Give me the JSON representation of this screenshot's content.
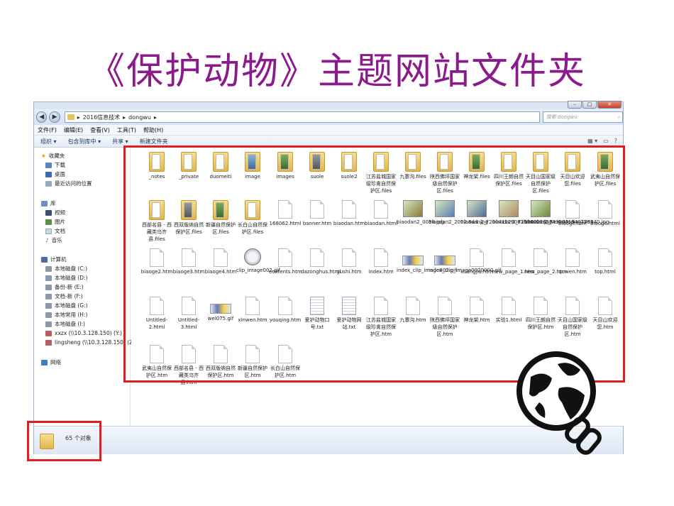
{
  "slide": {
    "title": "《保护动物》主题网站文件夹"
  },
  "explorer": {
    "address": {
      "segments": [
        "2016信息技术",
        "dongwu"
      ]
    },
    "search_placeholder": "搜索 dongwu",
    "menu": [
      "文件(F)",
      "编辑(E)",
      "查看(V)",
      "工具(T)",
      "帮助(H)"
    ],
    "toolbar": [
      "组织 ▾",
      "包含到库中 ▾",
      "共享 ▾",
      "新建文件夹"
    ],
    "sidebar": {
      "favorites": {
        "label": "收藏夹",
        "items": [
          "下载",
          "桌面",
          "最近访问的位置"
        ]
      },
      "libraries": {
        "label": "库",
        "items": [
          "视频",
          "图片",
          "文档",
          "音乐"
        ]
      },
      "computer": {
        "label": "计算机",
        "items": [
          "本地磁盘 (C:)",
          "本地磁盘 (D:)",
          "备份-新 (E:)",
          "文档-新 (F:)",
          "本地磁盘 (G:)",
          "本地常用 (H:)",
          "本地磁盘 (I:)",
          "xxzx (\\\\10.3.128.150) (Y:)",
          "lingsheng (\\\\10.3.128.150) (Z:)"
        ]
      },
      "network": {
        "label": "网络"
      }
    },
    "items": [
      {
        "name": "_notes",
        "type": "folder"
      },
      {
        "name": "_private",
        "type": "folder"
      },
      {
        "name": "duomeiti",
        "type": "folder"
      },
      {
        "name": "image",
        "type": "folder-blue"
      },
      {
        "name": "images",
        "type": "folder-green"
      },
      {
        "name": "suole",
        "type": "folder-gray"
      },
      {
        "name": "suole2",
        "type": "folder"
      },
      {
        "name": "江苏盐城国家级珍禽自然保护区.files",
        "type": "folder"
      },
      {
        "name": "九寨沟.files",
        "type": "folder"
      },
      {
        "name": "陕西佛坪国家级自然保护区.files",
        "type": "folder"
      },
      {
        "name": "神龙架.files",
        "type": "folder-green"
      },
      {
        "name": "四川王朗自然保护区.files",
        "type": "folder"
      },
      {
        "name": "天目山国家级自然保护区.files",
        "type": "folder"
      },
      {
        "name": "天目山欢迎您.files",
        "type": "folder"
      },
      {
        "name": "武夷山自然保护区.files",
        "type": "folder-green"
      },
      {
        "name": "西部名县 - 西藏类乌齐县.files",
        "type": "folder"
      },
      {
        "name": "西双版纳自然保护区.files",
        "type": "folder-gray"
      },
      {
        "name": "新疆自然保护区.files",
        "type": "folder-green"
      },
      {
        "name": "长白山自然保护区.files",
        "type": "folder"
      },
      {
        "name": "168062.html",
        "type": "file"
      },
      {
        "name": "banner.htm",
        "type": "file"
      },
      {
        "name": "biaodan.htm",
        "type": "file"
      },
      {
        "name": "biaodan.html",
        "type": "file"
      },
      {
        "name": "biaodan2_0038.jpg",
        "type": "photo",
        "color": "#8a7a3a"
      },
      {
        "name": "biaodan2_2002.8w1.jpg",
        "type": "photo",
        "color": "#5b7fb0"
      },
      {
        "name": "biaodan2_F20041129083534000.jpg",
        "type": "photo",
        "color": "#4a6a9a"
      },
      {
        "name": "biaodan2_F20060216174359319492989...",
        "type": "photo",
        "color": "#b08860"
      },
      {
        "name": "biaodan2_NewsMedia_176140.jpg",
        "type": "photo",
        "color": "#6a8a3a"
      },
      {
        "name": "biaoge.htm",
        "type": "file"
      },
      {
        "name": "biaoge.html",
        "type": "file"
      },
      {
        "name": "biaoge2.htm",
        "type": "file"
      },
      {
        "name": "biaoge3.htm",
        "type": "file"
      },
      {
        "name": "biaoge4.htm",
        "type": "file"
      },
      {
        "name": "clip_image002.gif",
        "type": "round"
      },
      {
        "name": "contents.htm",
        "type": "file"
      },
      {
        "name": "dazonghus.html",
        "type": "file"
      },
      {
        "name": "gushi.htm",
        "type": "file"
      },
      {
        "name": "index.htm",
        "type": "file"
      },
      {
        "name": "index_clip_image002.gif",
        "type": "gif"
      },
      {
        "name": "index_clip_image0020000.gif",
        "type": "gif"
      },
      {
        "name": "kuangjia.htm",
        "type": "file"
      },
      {
        "name": "new_page_1.htm",
        "type": "file"
      },
      {
        "name": "new_page_2.htm",
        "type": "file"
      },
      {
        "name": "quwen.htm",
        "type": "file"
      },
      {
        "name": "top.html",
        "type": "file"
      },
      {
        "name": "Untitled-2.html",
        "type": "file"
      },
      {
        "name": "Untitled-3.html",
        "type": "file"
      },
      {
        "name": "wel075.gif",
        "type": "gif"
      },
      {
        "name": "xinwen.htm",
        "type": "file"
      },
      {
        "name": "youqing.htm",
        "type": "file"
      },
      {
        "name": "爱护动物口号.txt",
        "type": "txt"
      },
      {
        "name": "爱护动物网站.txt",
        "type": "txt"
      },
      {
        "name": "江苏盐城国家级珍禽自然保护区.htm",
        "type": "file"
      },
      {
        "name": "九寨沟.htm",
        "type": "file"
      },
      {
        "name": "陕西佛坪国家级自然保护区.htm",
        "type": "file"
      },
      {
        "name": "神龙架.htm",
        "type": "file"
      },
      {
        "name": "实验1.html",
        "type": "file"
      },
      {
        "name": "四川王朗自然保护区.htm",
        "type": "file"
      },
      {
        "name": "天目山国家级自然保护区.htm",
        "type": "file"
      },
      {
        "name": "天目山欢迎您.htm",
        "type": "file"
      },
      {
        "name": "武夷山自然保护区.htm",
        "type": "file"
      },
      {
        "name": "西部名县 - 西藏类乌齐县.htm",
        "type": "file"
      },
      {
        "name": "西双版纳自然保护区.htm",
        "type": "file"
      },
      {
        "name": "新疆自然保护区.htm",
        "type": "file"
      },
      {
        "name": "长白山自然保护区.htm",
        "type": "file"
      }
    ],
    "status": {
      "count_text": "65 个对象"
    }
  },
  "colors": {
    "title": "#8b1a8b",
    "highlight": "#e02020"
  },
  "icons": {
    "overlay": "globe-chain-icon"
  }
}
